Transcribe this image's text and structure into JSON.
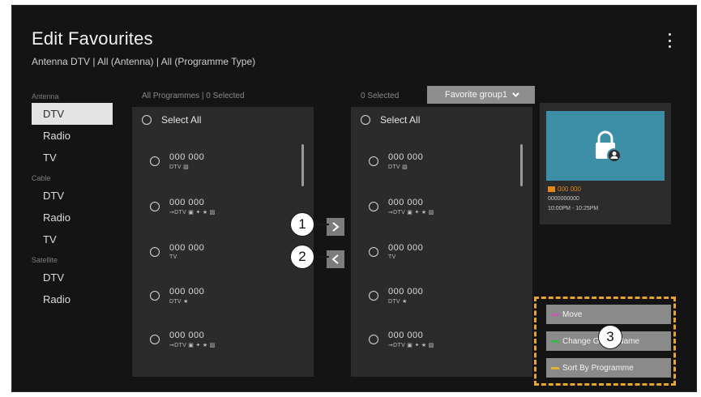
{
  "header": {
    "title": "Edit Favourites",
    "subtitle": "Antenna DTV | All (Antenna) | All (Programme Type)"
  },
  "sources": [
    {
      "group": "Antenna",
      "items": [
        "DTV",
        "Radio",
        "TV"
      ]
    },
    {
      "group": "Cable",
      "items": [
        "DTV",
        "Radio",
        "TV"
      ]
    },
    {
      "group": "Satellite",
      "items": [
        "DTV",
        "Radio"
      ]
    }
  ],
  "left_panel": {
    "header": "All Programmes | 0 Selected",
    "select_all": "Select All",
    "channels": [
      {
        "number": "000 000",
        "meta": "DTV ▨"
      },
      {
        "number": "000 000",
        "meta": "➞DTV ▣ ✦ ★ ▨"
      },
      {
        "number": "000 000",
        "meta": "TV"
      },
      {
        "number": "000 000",
        "meta": "DTV ★"
      },
      {
        "number": "000 000",
        "meta": "➞DTV ▣ ✦ ★ ▨"
      }
    ]
  },
  "right_panel": {
    "header": "0 Selected",
    "group_dropdown": "Favorite group1",
    "select_all": "Select All",
    "channels": [
      {
        "number": "000 000",
        "meta": "DTV ▨"
      },
      {
        "number": "000 000",
        "meta": "➞DTV ▣ ✦ ★ ▨"
      },
      {
        "number": "000 000",
        "meta": "TV"
      },
      {
        "number": "000 000",
        "meta": "DTV ★"
      },
      {
        "number": "000 000",
        "meta": "➞DTV ▣ ✦ ★ ▨"
      }
    ]
  },
  "callouts": {
    "add": "1",
    "remove": "2",
    "actions": "3"
  },
  "preview": {
    "icon": "lock-user-icon",
    "channel": "000 000",
    "programme": "0000000000",
    "time": "10:00PM - 10:25PM"
  },
  "actions": [
    {
      "label": "Move",
      "color": "#c05fb0"
    },
    {
      "label": "Change Group Name",
      "color": "#3fb34f"
    },
    {
      "label": "Sort By Programme",
      "color": "#e0b23a"
    }
  ],
  "colors": {
    "highlight": "#e7a52a",
    "accent_orange": "#e08a1c",
    "thumb": "#3d8fa8"
  }
}
